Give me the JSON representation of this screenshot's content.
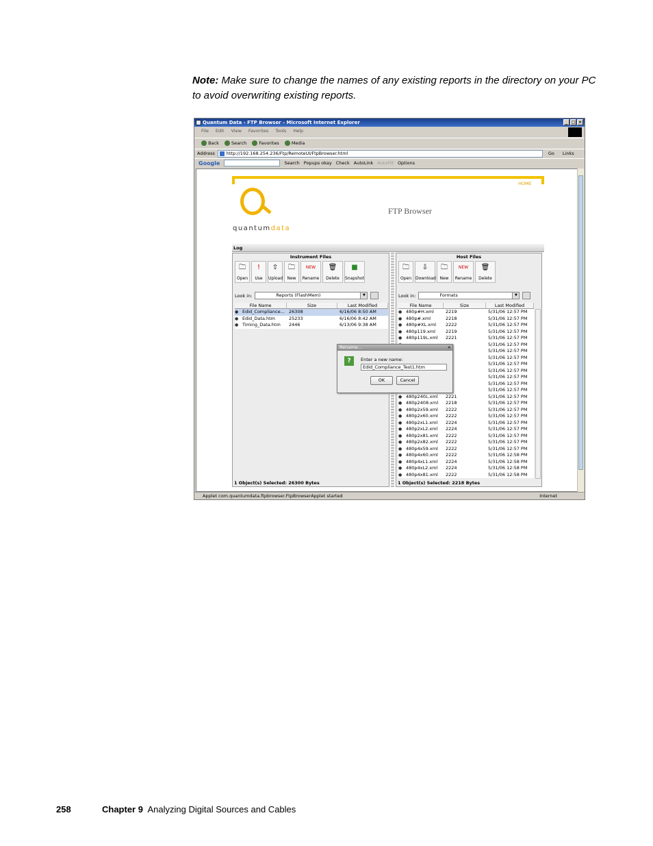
{
  "note": {
    "label": "Note:",
    "text": "Make sure to change the names of any existing reports in the directory on your PC to avoid overwriting existing reports."
  },
  "browser": {
    "title": "Quantum Data - FTP Browser - Microsoft Internet Explorer",
    "menu": [
      "File",
      "Edit",
      "View",
      "Favorites",
      "Tools",
      "Help"
    ],
    "toolbar": [
      "Back",
      "Search",
      "Favorites",
      "Media"
    ],
    "address_label": "Address",
    "address": "http://192.168.254.236/Ftp/RemoteUI/FtpBrowser.html",
    "go": "Go",
    "links": "Links",
    "google": {
      "logo": "Google",
      "items": [
        "Search",
        "Popups okay",
        "Check",
        "AutoLink",
        "AutoFill",
        "Options"
      ]
    },
    "status": "Applet com.quantumdata.ftpbrowser.FtpBrowserApplet started",
    "zone": "Internet"
  },
  "app": {
    "home": "HOME",
    "brand_a": "quantum",
    "brand_b": "data",
    "title": "FTP Browser",
    "log": "Log",
    "instrument": {
      "title": "Instrument Files",
      "tools": [
        "Open",
        "Use",
        "Upload",
        "New",
        "Rename",
        "Delete",
        "Snapshot"
      ],
      "lookin_label": "Look in:",
      "lookin": "Reports  (FlashMem)",
      "columns": [
        "File Name",
        "Size",
        "Last Modified"
      ],
      "rows": [
        {
          "name": "Edid_Compliance...",
          "size": "26308",
          "date": "6/16/06 8:50 AM"
        },
        {
          "name": "Edid_Data.htm",
          "size": "25233",
          "date": "6/16/06 8:42 AM"
        },
        {
          "name": "Timing_Data.htm",
          "size": "2446",
          "date": "6/13/06 9:38 AM"
        }
      ],
      "status": "1 Object(s) Selected:  26300 Bytes"
    },
    "host": {
      "title": "Host Files",
      "tools": [
        "Open",
        "Download",
        "New",
        "Rename",
        "Delete"
      ],
      "lookin_label": "Look in:",
      "lookin": "Formats",
      "columns": [
        "File Name",
        "Size",
        "Last Modified"
      ],
      "rows": [
        {
          "name": "480p#H.xml",
          "size": "2219",
          "date": "5/31/06 12:57 PM"
        },
        {
          "name": "480p#.xml",
          "size": "2218",
          "date": "5/31/06 12:57 PM"
        },
        {
          "name": "480p#XL.xml",
          "size": "2222",
          "date": "5/31/06 12:57 PM"
        },
        {
          "name": "480p119.xml",
          "size": "2219",
          "date": "5/31/06 12:57 PM"
        },
        {
          "name": "480p119L.xml",
          "size": "2221",
          "date": "5/31/06 12:57 PM"
        },
        {
          "name": "",
          "size": "",
          "date": "5/31/06 12:57 PM"
        },
        {
          "name": "",
          "size": "",
          "date": "5/31/06 12:57 PM"
        },
        {
          "name": "",
          "size": "",
          "date": "5/31/06 12:57 PM"
        },
        {
          "name": "",
          "size": "",
          "date": "5/31/06 12:57 PM"
        },
        {
          "name": "",
          "size": "",
          "date": "5/31/06 12:57 PM"
        },
        {
          "name": "",
          "size": "",
          "date": "5/31/06 12:57 PM"
        },
        {
          "name": "",
          "size": "",
          "date": "5/31/06 12:57 PM"
        },
        {
          "name": "",
          "size": "",
          "date": "5/31/06 12:57 PM"
        },
        {
          "name": "480p240L.xml",
          "size": "2221",
          "date": "5/31/06 12:57 PM"
        },
        {
          "name": "480p2408.xml",
          "size": "2218",
          "date": "5/31/06 12:57 PM"
        },
        {
          "name": "480p2x59.xml",
          "size": "2222",
          "date": "5/31/06 12:57 PM"
        },
        {
          "name": "480p2x60.xml",
          "size": "2222",
          "date": "5/31/06 12:57 PM"
        },
        {
          "name": "480p2xL1.xml",
          "size": "2224",
          "date": "5/31/06 12:57 PM"
        },
        {
          "name": "480p2xL2.xml",
          "size": "2224",
          "date": "5/31/06 12:57 PM"
        },
        {
          "name": "480p2x81.xml",
          "size": "2222",
          "date": "5/31/06 12:57 PM"
        },
        {
          "name": "480p2x82.xml",
          "size": "2222",
          "date": "5/31/06 12:57 PM"
        },
        {
          "name": "480p4x59.xml",
          "size": "2222",
          "date": "5/31/06 12:57 PM"
        },
        {
          "name": "480p4x60.xml",
          "size": "2222",
          "date": "5/31/06 12:58 PM"
        },
        {
          "name": "480p4xL1.xml",
          "size": "2224",
          "date": "5/31/06 12:58 PM"
        },
        {
          "name": "480p4xL2.xml",
          "size": "2224",
          "date": "5/31/06 12:58 PM"
        },
        {
          "name": "480p4x81.xml",
          "size": "2222",
          "date": "5/31/06 12:58 PM"
        }
      ],
      "status": "1 Object(s) Selected:  2218 Bytes"
    },
    "dialog": {
      "title": "Rename...",
      "label": "Enter a new name:",
      "value": "Edid_Compliance_Test1.htm",
      "ok": "OK",
      "cancel": "Cancel"
    }
  },
  "footer": {
    "page": "258",
    "chapter": "Chapter 9",
    "title": "Analyzing Digital Sources and Cables"
  }
}
